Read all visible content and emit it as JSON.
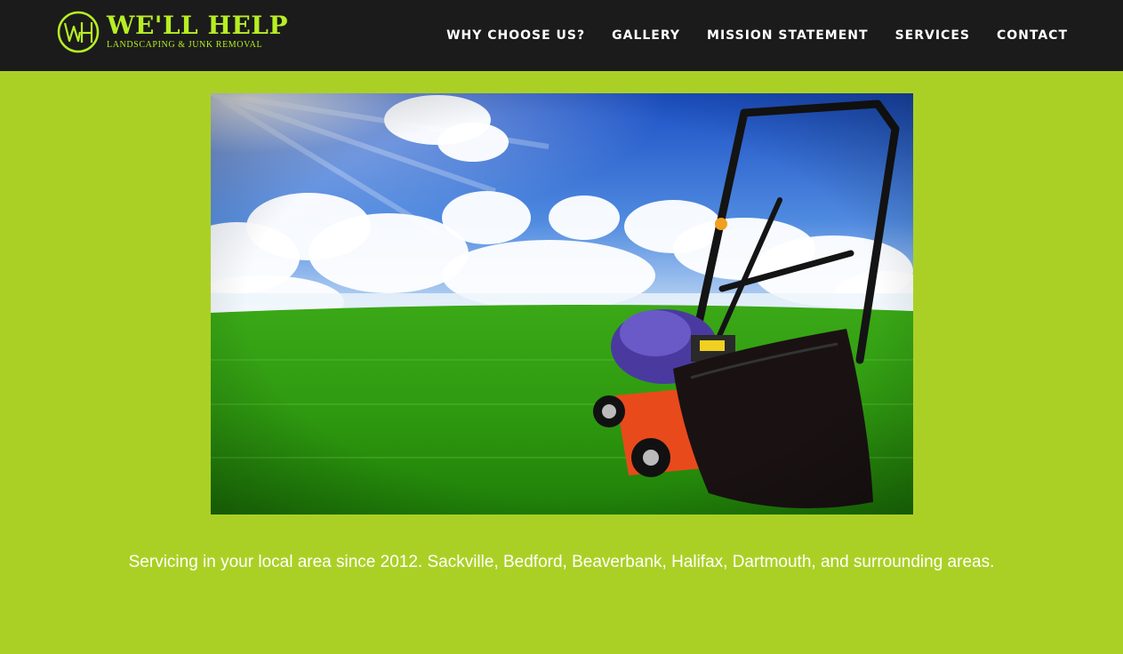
{
  "brand": {
    "monogram": "WH",
    "title": "WE'LL HELP",
    "subtitle": "LANDSCAPING & JUNK REMOVAL"
  },
  "nav": [
    {
      "label": "WHY CHOOSE US?"
    },
    {
      "label": "GALLERY"
    },
    {
      "label": "MISSION STATEMENT"
    },
    {
      "label": "SERVICES"
    },
    {
      "label": "CONTACT"
    }
  ],
  "hero": {
    "description": "Lawn mower with grass catcher on a green lawn under a blue sky"
  },
  "tagline": "Servicing in your local area since 2012. Sackville, Bedford, Beaverbank, Halifax, Dartmouth, and surrounding areas.",
  "colors": {
    "page_background": "#abd025",
    "header_background": "#1b1b1b",
    "brand_accent": "#b7ee24",
    "nav_text": "#ffffff"
  }
}
